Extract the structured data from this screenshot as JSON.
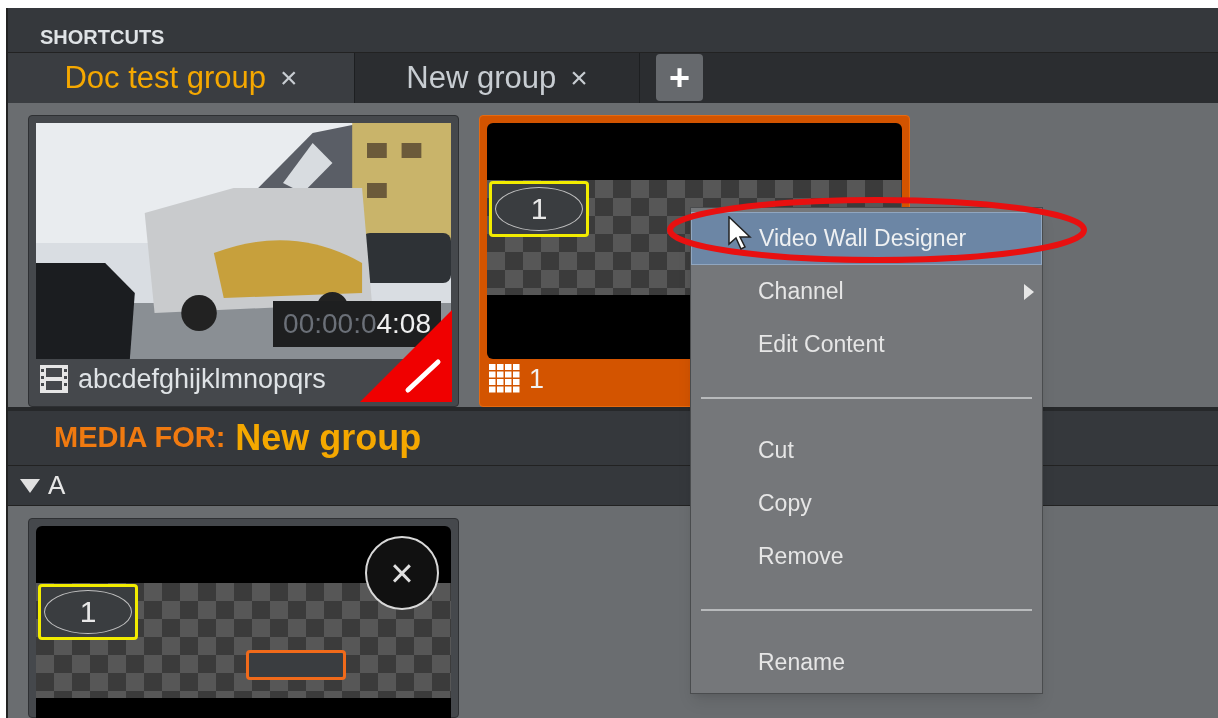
{
  "panel_title": "SHORTCUTS",
  "tabs": [
    {
      "label": "Doc test group",
      "close": "×",
      "selected": true
    },
    {
      "label": "New group",
      "close": "×",
      "selected": false
    }
  ],
  "add_tab": "+",
  "shortcuts": [
    {
      "kind": "media",
      "name": "abcdefghijklmnopqrs",
      "timecode_dim": "00:00:0",
      "timecode_lit": "4:08",
      "selected": false
    },
    {
      "kind": "videowall",
      "name": "1",
      "display_label": "1",
      "selected": true
    }
  ],
  "media_header": {
    "prefix": "MEDIA FOR:",
    "group": "New group"
  },
  "section": {
    "label": "A",
    "expanded": true
  },
  "media": [
    {
      "kind": "videowall",
      "display_label": "1",
      "close": "×"
    }
  ],
  "context_menu": {
    "items": [
      {
        "kind": "item",
        "label": "Video Wall Designer",
        "selected": true
      },
      {
        "kind": "submenu",
        "label": "Channel",
        "selected": false
      },
      {
        "kind": "item",
        "label": "Edit Content",
        "selected": false
      },
      {
        "kind": "separator"
      },
      {
        "kind": "item",
        "label": "Cut",
        "selected": false
      },
      {
        "kind": "item",
        "label": "Copy",
        "selected": false
      },
      {
        "kind": "item",
        "label": "Remove",
        "selected": false
      },
      {
        "kind": "separator"
      },
      {
        "kind": "item",
        "label": "Rename",
        "selected": false
      }
    ]
  }
}
